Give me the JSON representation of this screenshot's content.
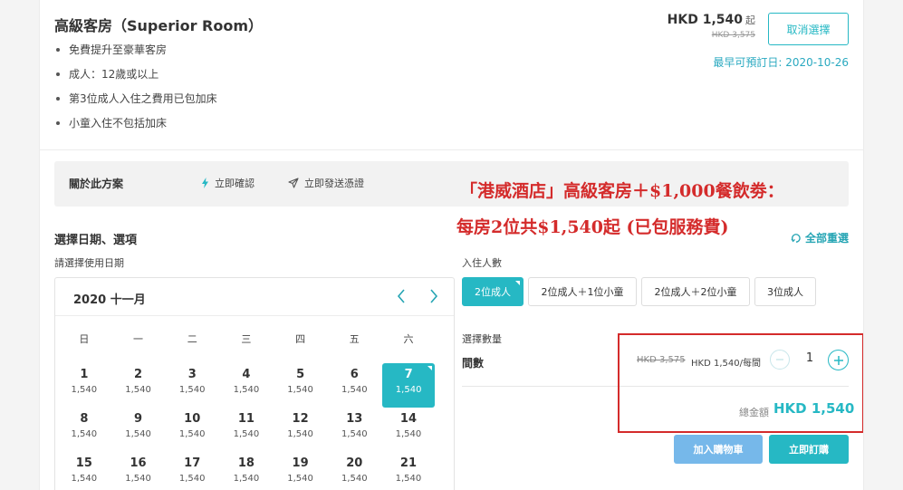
{
  "room": {
    "title": "高級客房（Superior Room）",
    "features": [
      "免費提升至豪華客房",
      "成人：12歲或以上",
      "第3位成人入住之費用已包加床",
      "小童入住不包括加床"
    ],
    "price": "HKD 1,540",
    "price_suffix": "起",
    "price_original": "HKD 3,575",
    "cancel_label": "取消選擇",
    "earliest": "最早可預訂日: 2020-10-26"
  },
  "about": {
    "label": "關於此方案",
    "instant_confirm": "立即確認",
    "instant_voucher": "立即發送憑證"
  },
  "promo": {
    "line1": "「港威酒店」高級客房＋$1,000餐飲劵：",
    "line2": "每房2位共$1,540起 (已包服務費)"
  },
  "selection": {
    "title": "選擇日期、選項",
    "subtitle": "請選擇使用日期",
    "reset_label": "全部重選"
  },
  "calendar": {
    "month": "2020 十一月",
    "weekdays": [
      "日",
      "一",
      "二",
      "三",
      "四",
      "五",
      "六"
    ],
    "days": [
      {
        "d": "1",
        "p": "1,540"
      },
      {
        "d": "2",
        "p": "1,540"
      },
      {
        "d": "3",
        "p": "1,540"
      },
      {
        "d": "4",
        "p": "1,540"
      },
      {
        "d": "5",
        "p": "1,540"
      },
      {
        "d": "6",
        "p": "1,540"
      },
      {
        "d": "7",
        "p": "1,540"
      },
      {
        "d": "8",
        "p": "1,540"
      },
      {
        "d": "9",
        "p": "1,540"
      },
      {
        "d": "10",
        "p": "1,540"
      },
      {
        "d": "11",
        "p": "1,540"
      },
      {
        "d": "12",
        "p": "1,540"
      },
      {
        "d": "13",
        "p": "1,540"
      },
      {
        "d": "14",
        "p": "1,540"
      },
      {
        "d": "15",
        "p": "1,540"
      },
      {
        "d": "16",
        "p": "1,540"
      },
      {
        "d": "17",
        "p": "1,540"
      },
      {
        "d": "18",
        "p": "1,540"
      },
      {
        "d": "19",
        "p": "1,540"
      },
      {
        "d": "20",
        "p": "1,540"
      },
      {
        "d": "21",
        "p": "1,540"
      }
    ],
    "selected_day": "7"
  },
  "guests": {
    "label": "入住人數",
    "options": [
      "2位成人",
      "2位成人＋1位小童",
      "2位成人＋2位小童",
      "3位成人"
    ],
    "selected": "2位成人"
  },
  "quantity": {
    "label": "選擇數量",
    "unit_label": "間數",
    "unit_old": "HKD 3,575",
    "unit_price": "HKD 1,540/每間",
    "value": "1",
    "total_label": "總金額",
    "total": "HKD 1,540"
  },
  "actions": {
    "cart_label": "加入購物車",
    "book_label": "立即訂購"
  },
  "colors": {
    "accent": "#26b8c4",
    "cart": "#76b8ea",
    "promo_red": "#d42b2b"
  }
}
